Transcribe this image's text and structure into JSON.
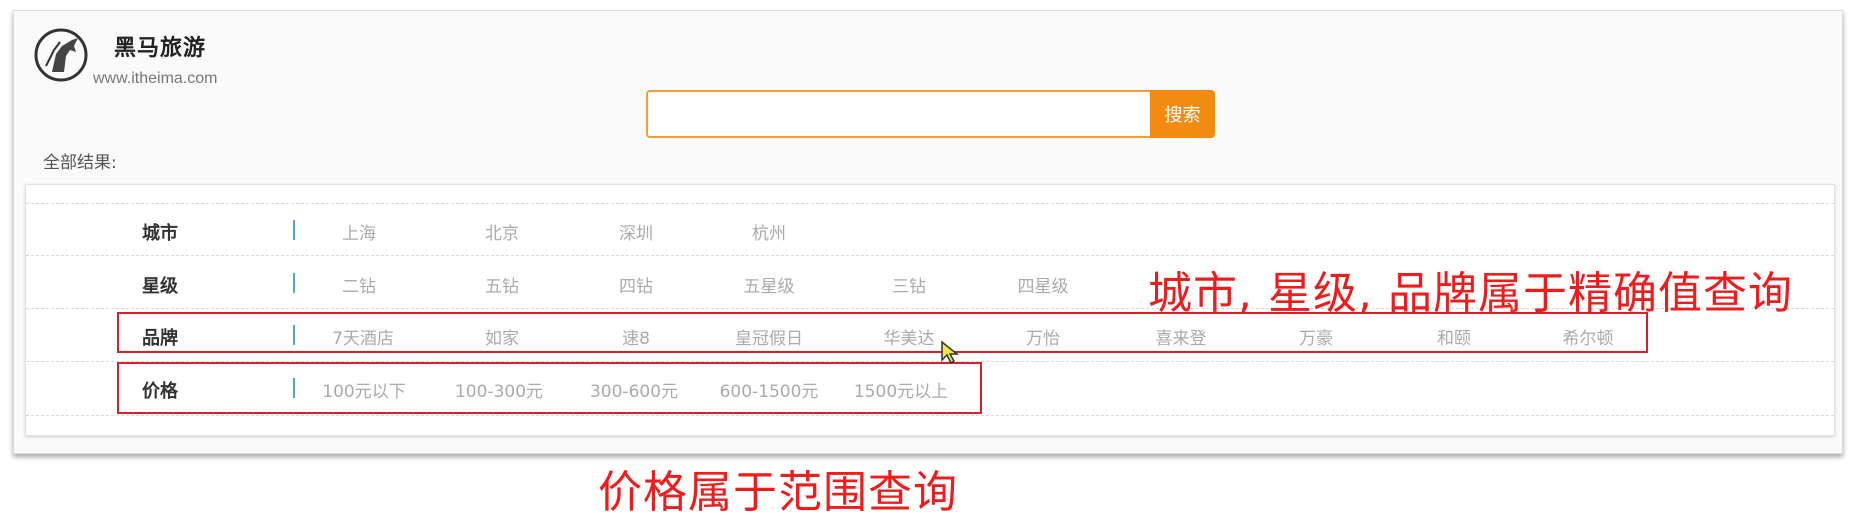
{
  "brand": {
    "name": "黑马旅游",
    "url": "www.itheima.com"
  },
  "search": {
    "value": "",
    "placeholder": "",
    "button_label": "搜索"
  },
  "results_label": "全部结果:",
  "filters": {
    "city": {
      "label": "城市",
      "options": [
        "上海",
        "北京",
        "深圳",
        "杭州"
      ]
    },
    "star": {
      "label": "星级",
      "options": [
        "二钻",
        "五钻",
        "四钻",
        "五星级",
        "三钻",
        "四星级"
      ]
    },
    "brand": {
      "label": "品牌",
      "options": [
        "7天酒店",
        "如家",
        "速8",
        "皇冠假日",
        "华美达",
        "万怡",
        "喜来登",
        "万豪",
        "和颐",
        "希尔顿"
      ]
    },
    "price": {
      "label": "价格",
      "options": [
        "100元以下",
        "100-300元",
        "300-600元",
        "600-1500元",
        "1500元以上"
      ]
    }
  },
  "annotations": {
    "exact_query": "城市, 星级, 品牌属于精确值查询",
    "range_query": "价格属于范围查询"
  },
  "colors": {
    "accent": "#f38b13",
    "annotation": "#ee1c1c",
    "separator": "#5aa0d8"
  }
}
